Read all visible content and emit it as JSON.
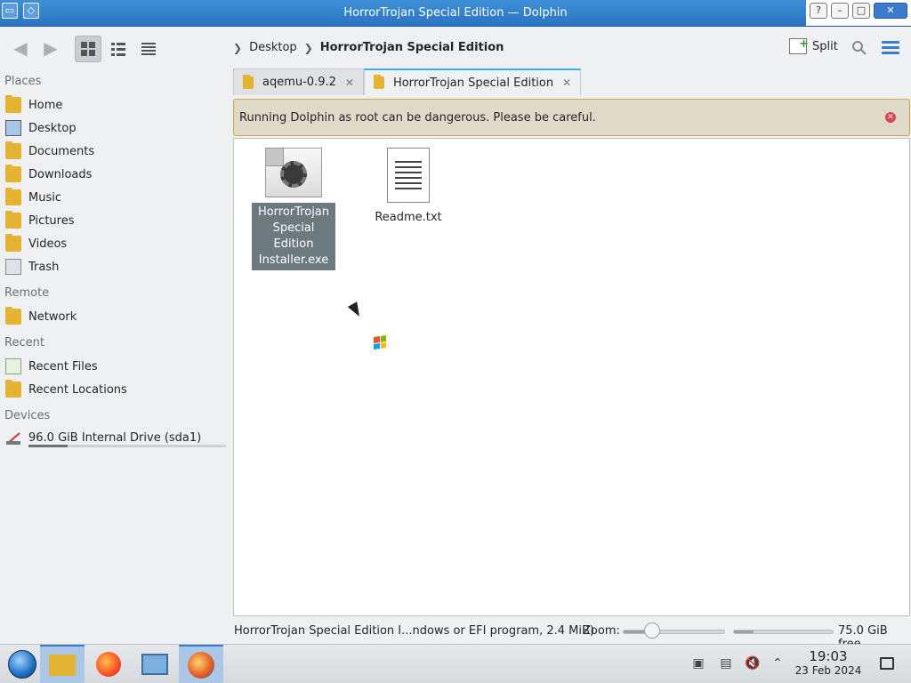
{
  "window": {
    "title": "HorrorTrojan Special Edition — Dolphin",
    "buttons": [
      "?",
      "–",
      "□",
      "✕"
    ]
  },
  "toolbar": {
    "back_icon": "arrow-left-icon",
    "forward_icon": "arrow-right-icon",
    "views": [
      "icons-view-icon",
      "compact-view-icon",
      "details-view-icon"
    ],
    "split_label": "Split"
  },
  "breadcrumb": {
    "items": [
      "Desktop",
      "HorrorTrojan Special Edition"
    ]
  },
  "sidebar": {
    "places_title": "Places",
    "places": [
      "Home",
      "Desktop",
      "Documents",
      "Downloads",
      "Music",
      "Pictures",
      "Videos",
      "Trash"
    ],
    "remote_title": "Remote",
    "remote": [
      "Network"
    ],
    "recent_title": "Recent",
    "recent": [
      "Recent Files",
      "Recent Locations"
    ],
    "devices_title": "Devices",
    "devices": [
      "96.0 GiB Internal Drive (sda1)"
    ],
    "drive_usage_fraction": 0.2
  },
  "tabs": [
    {
      "label": "aqemu-0.9.2",
      "active": false
    },
    {
      "label": "HorrorTrojan Special Edition",
      "active": true
    }
  ],
  "warning": {
    "text": "Running Dolphin as root can be dangerous. Please be careful."
  },
  "files": [
    {
      "line1": "HorrorTrojan",
      "line2": "Special Edition",
      "line3": "Installer.exe",
      "selected": true
    },
    {
      "line1": "Readme.txt",
      "selected": false
    }
  ],
  "statusbar": {
    "text": "HorrorTrojan Special Edition I...ndows or EFI program, 2.4 MiB)",
    "zoom_label": "Zoom:",
    "free_label": "75.0 GiB free"
  },
  "taskbar": {
    "time": "19:03",
    "date": "23 Feb 2024"
  },
  "colors": {
    "accent": "#3a7ad0",
    "warning_bg": "#e0dbc8",
    "selection": "#6c7a80"
  }
}
